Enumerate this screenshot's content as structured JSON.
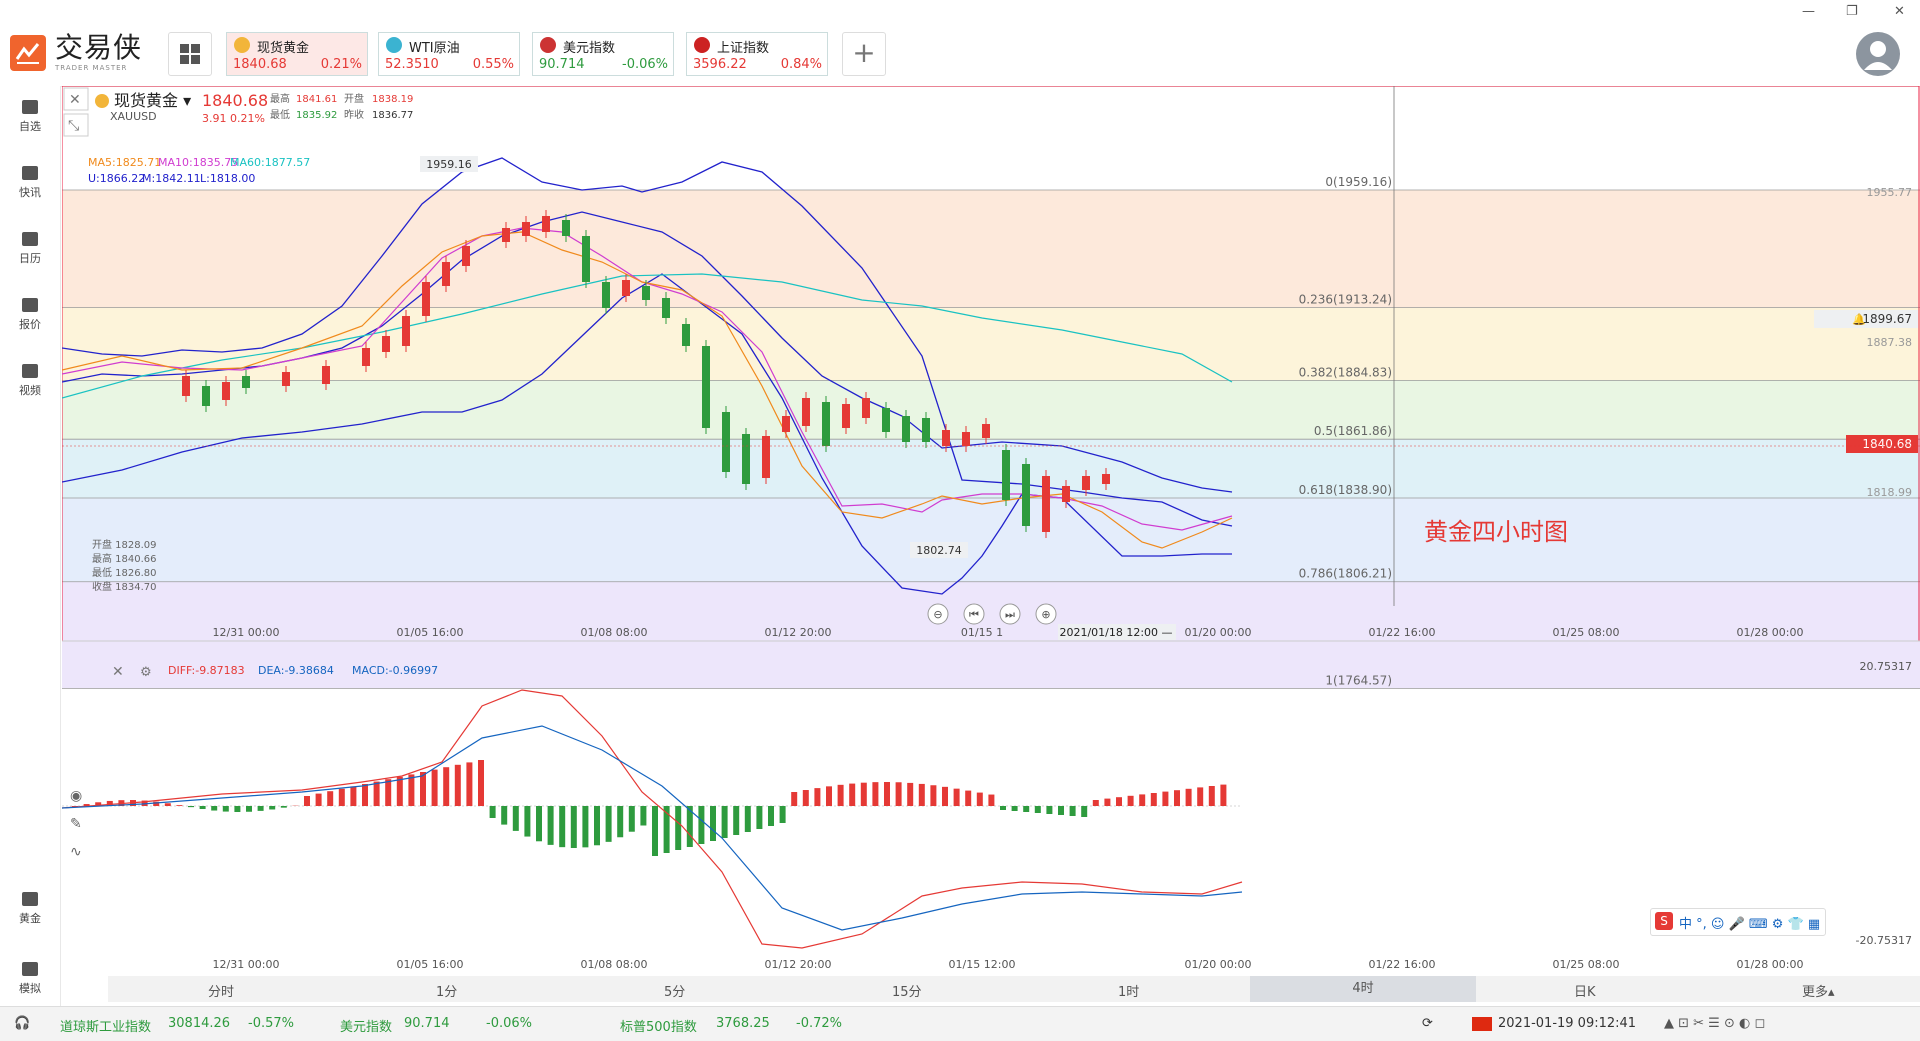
{
  "app": {
    "logo_cn": "交易侠",
    "logo_en": "TRADER MASTER"
  },
  "tickers": [
    {
      "name": "现货黄金",
      "price": "1840.68",
      "change": "0.21%",
      "price_color": "#e53935",
      "bg": "#fde8e6",
      "icon_color": "#f2b53a"
    },
    {
      "name": "WTI原油",
      "price": "52.3510",
      "change": "0.55%",
      "price_color": "#e53935",
      "bg": "#ffffff",
      "icon_color": "#3bb3d1"
    },
    {
      "name": "美元指数",
      "price": "90.714",
      "change": "-0.06%",
      "price_color": "#2e9b3e",
      "bg": "#ffffff",
      "icon_color": "#c33"
    },
    {
      "name": "上证指数",
      "price": "3596.22",
      "change": "0.84%",
      "price_color": "#e53935",
      "bg": "#ffffff",
      "icon_color": "#c22"
    }
  ],
  "sidebar": [
    {
      "label": "自选",
      "icon": "bookmark-plus-icon"
    },
    {
      "label": "快讯",
      "icon": "news-icon"
    },
    {
      "label": "日历",
      "icon": "calendar-icon"
    },
    {
      "label": "报价",
      "icon": "trend-icon"
    },
    {
      "label": "视频",
      "icon": "video-icon"
    },
    {
      "label": "黄金",
      "icon": "gold-icon"
    },
    {
      "label": "模拟",
      "icon": "simulate-icon"
    }
  ],
  "instrument": {
    "name": "现货黄金",
    "code": "XAUUSD",
    "price": "1840.68",
    "chg": "3.91",
    "chg_pct": "0.21%",
    "high_label": "最高",
    "high": "1841.61",
    "open_label": "开盘",
    "open": "1838.19",
    "low_label": "最低",
    "low": "1835.92",
    "prev_label": "昨收",
    "prev": "1836.77"
  },
  "ma": {
    "ma5": "MA5:1825.71",
    "ma10": "MA10:1835.75",
    "ma60": "MA60:1877.57"
  },
  "boll": {
    "u": "U:1866.22",
    "m": "M:1842.11",
    "l": "L:1818.00"
  },
  "fib": [
    "0(1959.16)",
    "0.236(1913.24)",
    "0.382(1884.83)",
    "0.5(1861.86)",
    "0.618(1838.90)",
    "0.786(1806.21)",
    "1(1764.57)"
  ],
  "price_axis": {
    "p1955": "1955.77",
    "p1899": "1899.67",
    "p1887": "1887.38",
    "p1840": "1840.68",
    "p1818": "1818.99"
  },
  "annot": {
    "high": "1959.16",
    "low": "1802.74",
    "title": "黄金四小时图"
  },
  "bar_info": [
    "开盘 1828.09",
    "最高 1840.66",
    "最低 1826.80",
    "收盘 1834.70"
  ],
  "time_axis": [
    "12/31 00:00",
    "01/05 16:00",
    "01/08 08:00",
    "01/12 20:00",
    "01/15 1",
    "01/20 00:00",
    "01/22 16:00",
    "01/25 08:00",
    "01/28 00:00"
  ],
  "crosshair_time": "2021/01/18 12:00 —",
  "macd": {
    "diff": "DIFF:-9.87183",
    "dea": "DEA:-9.38684",
    "macd": "MACD:-0.96997",
    "top": "20.75317",
    "bottom": "-20.75317"
  },
  "macd_time_axis": [
    "12/31 00:00",
    "01/05 16:00",
    "01/08 08:00",
    "01/12 20:00",
    "01/15 12:00",
    "01/20 00:00",
    "01/22 16:00",
    "01/25 08:00",
    "01/28 00:00"
  ],
  "periods": [
    "分时",
    "1分",
    "5分",
    "15分",
    "1时",
    "4时",
    "日K",
    "更多▴"
  ],
  "active_period": "4时",
  "status": [
    {
      "name": "道琼斯工业指数",
      "value": "30814.26",
      "chg": "-0.57%"
    },
    {
      "name": "美元指数",
      "value": "90.714",
      "chg": "-0.06%"
    },
    {
      "name": "标普500指数",
      "value": "3768.25",
      "chg": "-0.72%"
    }
  ],
  "clock": "2021-01-19 09:12:41",
  "colors": {
    "up": "#e53935",
    "down": "#2e9b3e",
    "accent": "#f0642d"
  }
}
